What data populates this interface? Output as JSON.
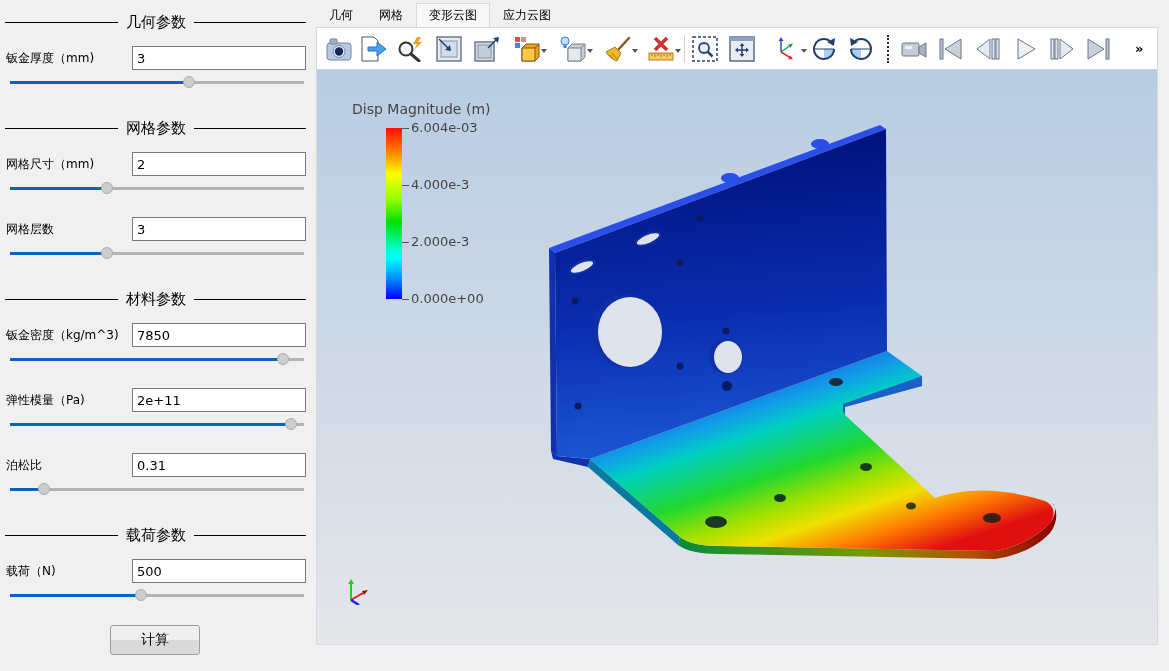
{
  "sections": [
    {
      "title": "几何参数",
      "params": [
        {
          "label": "钣金厚度（mm)",
          "value": "3",
          "level": 0.61
        }
      ]
    },
    {
      "title": "网格参数",
      "params": [
        {
          "label": "网格尺寸（mm)",
          "value": "2",
          "level": 0.33
        },
        {
          "label": "网格层数",
          "value": "3",
          "level": 0.33
        }
      ]
    },
    {
      "title": "材料参数",
      "params": [
        {
          "label": "钣金密度（kg/m^3)",
          "value": "7850",
          "level": 0.93
        },
        {
          "label": "弹性模量（Pa)",
          "value": "2e+11",
          "level": 0.955
        },
        {
          "label": "泊松比",
          "value": "0.31",
          "level": 0.115
        }
      ]
    },
    {
      "title": "载荷参数",
      "params": [
        {
          "label": "载荷（N)",
          "value": "500",
          "level": 0.445
        }
      ]
    }
  ],
  "compute_button": "计算",
  "tabs": [
    {
      "label": "几何",
      "selected": false
    },
    {
      "label": "网格",
      "selected": false
    },
    {
      "label": "变形云图",
      "selected": true
    },
    {
      "label": "应力云图",
      "selected": false
    }
  ],
  "toolbar": {
    "overflow": "»"
  },
  "viewport": {
    "legend": {
      "title": "Disp Magnitude (m)",
      "ticks": [
        "6.004e-03",
        "4.000e-3",
        "2.000e-3",
        "0.000e+00"
      ]
    }
  }
}
